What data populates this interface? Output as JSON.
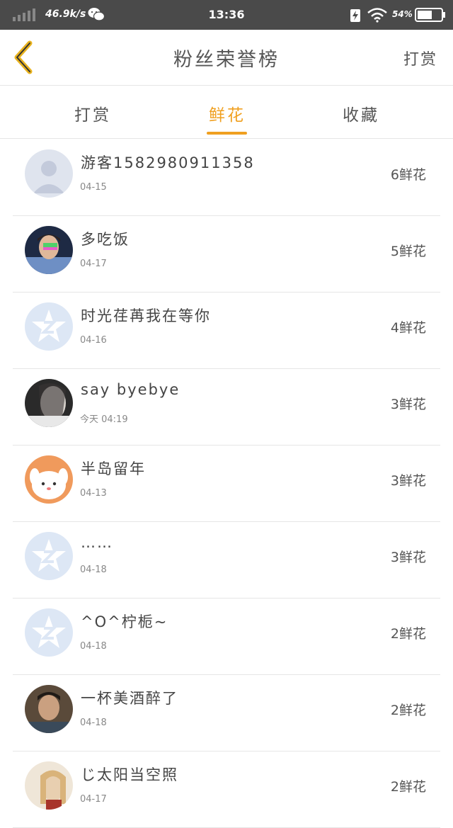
{
  "status_bar": {
    "net_speed": "46.9k/s",
    "time": "13:36",
    "battery_pct": "54%"
  },
  "header": {
    "title": "粉丝荣誉榜",
    "action": "打赏"
  },
  "tabs": [
    {
      "label": "打赏",
      "active": false
    },
    {
      "label": "鲜花",
      "active": true
    },
    {
      "label": "收藏",
      "active": false
    }
  ],
  "colors": {
    "accent": "#f0a020",
    "status_bar_bg": "#4a4a4a"
  },
  "fans": [
    {
      "name": "游客1582980911358",
      "date": "04-15",
      "gift": "6鲜花",
      "avatar": "default-user-icon"
    },
    {
      "name": "多吃饭",
      "date": "04-17",
      "gift": "5鲜花",
      "avatar": "user-photo"
    },
    {
      "name": "时光荏苒我在等你",
      "date": "04-16",
      "gift": "4鲜花",
      "avatar": "qzone-star-icon"
    },
    {
      "name": "say byebye",
      "date": "今天 04:19",
      "gift": "3鲜花",
      "avatar": "user-photo"
    },
    {
      "name": "半岛留年",
      "date": "04-13",
      "gift": "3鲜花",
      "avatar": "cartoon-dog-photo"
    },
    {
      "name": "……",
      "date": "04-18",
      "gift": "3鲜花",
      "avatar": "qzone-star-icon"
    },
    {
      "name": "^O^柠栀~",
      "date": "04-18",
      "gift": "2鲜花",
      "avatar": "qzone-star-icon"
    },
    {
      "name": "一杯美酒醉了",
      "date": "04-18",
      "gift": "2鲜花",
      "avatar": "user-photo"
    },
    {
      "name": "じ太阳当空照",
      "date": "04-17",
      "gift": "2鲜花",
      "avatar": "user-photo"
    }
  ]
}
